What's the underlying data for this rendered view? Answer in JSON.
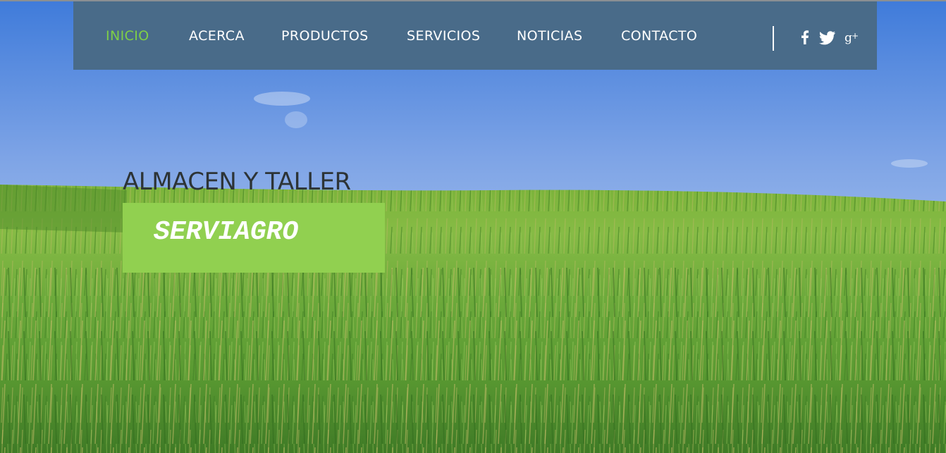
{
  "nav": {
    "items": [
      {
        "label": "INICIO",
        "active": true
      },
      {
        "label": "ACERCA",
        "active": false
      },
      {
        "label": "PRODUCTOS",
        "active": false
      },
      {
        "label": "SERVICIOS",
        "active": false
      },
      {
        "label": "NOTICIAS",
        "active": false
      },
      {
        "label": "CONTACTO",
        "active": false
      }
    ],
    "social": [
      "facebook-icon",
      "twitter-icon",
      "google-plus-icon"
    ]
  },
  "hero": {
    "subtitle": "ALMACEN Y TALLER",
    "brand": "SERVIAGRO"
  },
  "colors": {
    "navbar": "#496b89",
    "active_link": "#7fcf47",
    "brand_box": "#91d050",
    "sky_top": "#3c78d8",
    "grass": "#5a9e2c"
  }
}
